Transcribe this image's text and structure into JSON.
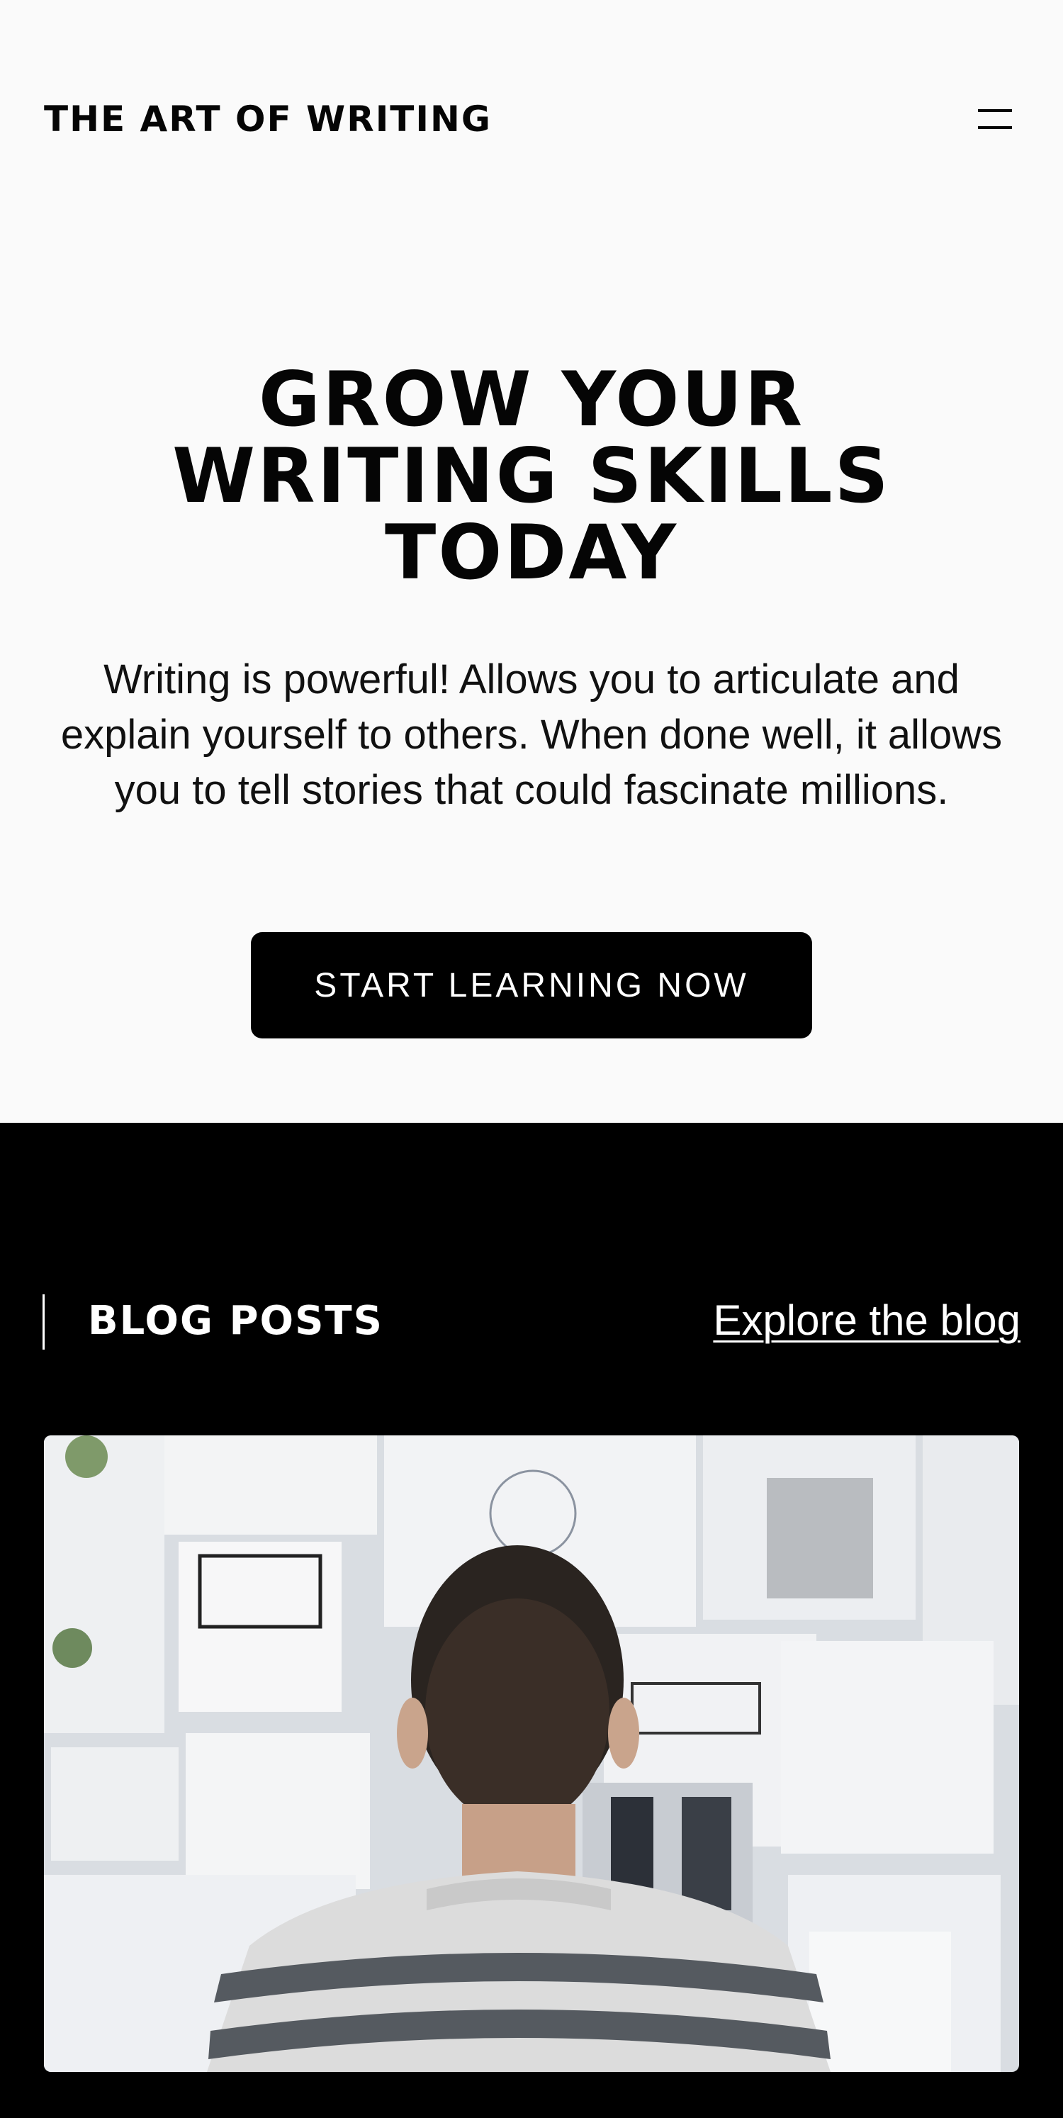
{
  "header": {
    "logo_text": "THE ART OF WRITING",
    "menu_icon": "hamburger-menu-icon"
  },
  "hero": {
    "title_lines": [
      "GROW YOUR",
      "WRITING SKILLS",
      "TODAY"
    ],
    "description": "Writing is powerful! Allows you to articulate and explain yourself to others. When done well, it allows you to tell stories that could fascinate millions.",
    "cta_label": "START LEARNING NOW"
  },
  "blog": {
    "section_title": "BLOG POSTS",
    "explore_link": "Explore the blog",
    "posts": [
      {
        "image": "person-facing-wall-of-sketches-photo"
      }
    ]
  },
  "colors": {
    "page_bg": "#fafafa",
    "text": "#050505",
    "button_bg": "#000000",
    "button_text": "#ffffff",
    "blog_bg": "#000000",
    "blog_text": "#ffffff"
  }
}
